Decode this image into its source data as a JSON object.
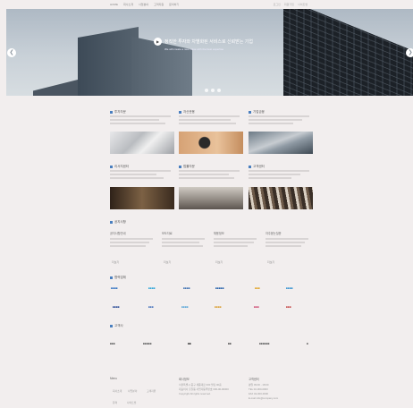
{
  "topnav": {
    "menu": [
      "HOME",
      "회사소개",
      "사업분야",
      "고객지원",
      "문의하기"
    ],
    "util": [
      "로그인",
      "회원가입",
      "사이트맵"
    ]
  },
  "hero": {
    "headline": "정직한 투자와 차별화된 서비스로 신뢰받는 기업",
    "subline": "We will create a new value with the best expertise",
    "slide_count": 3
  },
  "services": {
    "row1": [
      {
        "title": "투자자문",
        "more": "더보기"
      },
      {
        "title": "자산운용",
        "more": "더보기"
      },
      {
        "title": "기업금융",
        "more": "더보기"
      }
    ],
    "row2": [
      {
        "title": "리서치센터",
        "more": "더보기"
      },
      {
        "title": "법률자문",
        "more": "더보기"
      },
      {
        "title": "고객센터",
        "more": "더보기"
      }
    ]
  },
  "notice": {
    "title": "공지사항",
    "columns": [
      {
        "title": "공지사항안내",
        "more": "더보기"
      },
      {
        "title": "보도자료",
        "more": "더보기"
      },
      {
        "title": "채용정보",
        "more": "더보기"
      },
      {
        "title": "자주묻는질문",
        "more": "더보기"
      }
    ]
  },
  "partners": {
    "title": "협력업체",
    "logos_row1": [
      {
        "text": "■■■■",
        "color": "#2d6fc0"
      },
      {
        "text": "■■■■",
        "color": "#2aa3d8"
      },
      {
        "text": "■■■■",
        "color": "#3c6fb0"
      },
      {
        "text": "■■■■■",
        "color": "#1f5ca8"
      },
      {
        "text": "■■■",
        "color": "#e0a020"
      },
      {
        "text": "■■■■",
        "color": "#2f8fd0"
      }
    ],
    "logos_row2": [
      {
        "text": "■■■■",
        "color": "#1d3f8f"
      },
      {
        "text": "■■■",
        "color": "#3a69b8"
      },
      {
        "text": "■■■■",
        "color": "#4fa2d6"
      },
      {
        "text": "■■■■",
        "color": "#d89a2a"
      },
      {
        "text": "■■■",
        "color": "#cc3f6a"
      },
      {
        "text": "■■■",
        "color": "#c23b3b"
      }
    ]
  },
  "clients": {
    "title": "고객사",
    "logos": [
      {
        "text": "■■■",
        "color": "#555555"
      },
      {
        "text": "■■■■■",
        "color": "#555555"
      },
      {
        "text": "■■",
        "color": "#222222"
      },
      {
        "text": "■■",
        "color": "#444444"
      },
      {
        "text": "■■■■■■",
        "color": "#555555"
      },
      {
        "text": "■",
        "color": "#555555"
      }
    ]
  },
  "footer": {
    "col1_title": "Menu",
    "col1_links": [
      "회사소개",
      "사업분야",
      "고객지원",
      "문의",
      "사이트맵"
    ],
    "col2_title": "회사정보",
    "col2_lines": [
      "서울특별시 중구 세종대로 000 빌딩 00층",
      "대표이사 홍길동 사업자등록번호 000-00-00000",
      "Copyright All rights reserved."
    ],
    "col3_title": "고객센터",
    "col3_lines": [
      "평일 09:00 - 18:00",
      "TEL 02-000-0000",
      "FAX 02-000-0000",
      "E-mail info@company.com"
    ]
  },
  "colors": {
    "background": "#f2eeee",
    "accent": "#4a7fbf"
  }
}
